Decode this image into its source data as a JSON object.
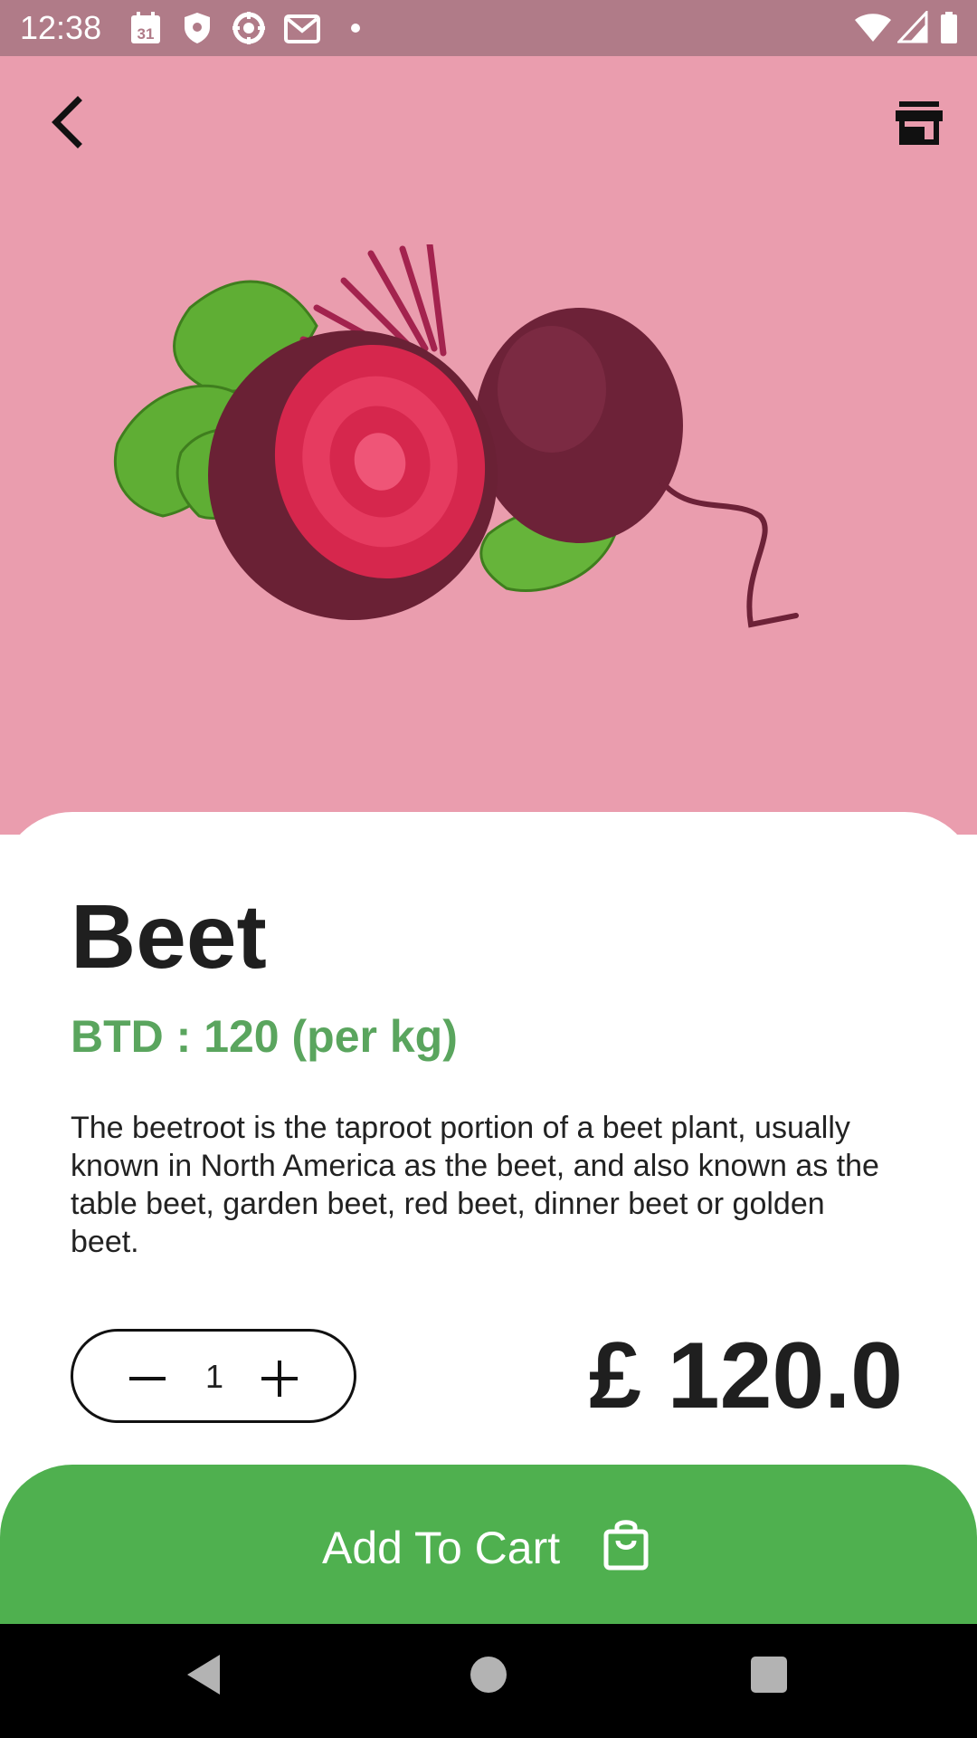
{
  "status_bar": {
    "time": "12:38",
    "calendar_day": "31",
    "icons_left": [
      "calendar-icon",
      "shield-icon",
      "settings-flower-icon",
      "gmail-icon",
      "dot-icon"
    ],
    "icons_right": [
      "wifi-icon",
      "signal-icon",
      "battery-icon"
    ]
  },
  "header": {
    "back_icon": "chevron-left-icon",
    "store_icon": "storefront-icon"
  },
  "product": {
    "name": "Beet",
    "unit_price": "BTD : 120 (per kg)",
    "description": "The beetroot is the taproot portion of a beet plant, usually known in North America as the beet, and also known as the table beet, garden beet, red beet, dinner beet or golden beet.",
    "quantity": "1",
    "total": "£ 120.0"
  },
  "actions": {
    "add_to_cart_label": "Add To Cart"
  },
  "colors": {
    "hero_bg": "#ea9dae",
    "status_bg": "#b07b88",
    "price_green": "#5aa55e",
    "button_green": "#4fb04f"
  }
}
